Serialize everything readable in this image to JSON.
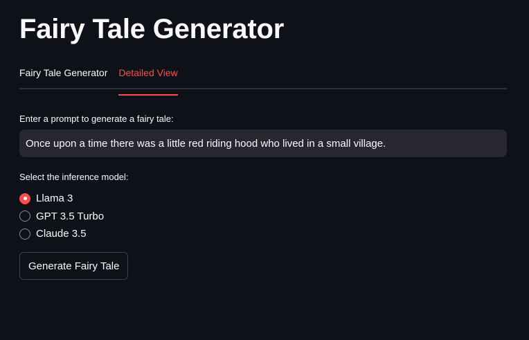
{
  "app": {
    "title": "Fairy Tale Generator"
  },
  "tabs": [
    {
      "label": "Fairy Tale Generator",
      "active": false
    },
    {
      "label": "Detailed View",
      "active": true
    }
  ],
  "prompt": {
    "label": "Enter a prompt to generate a fairy tale:",
    "value": "Once upon a time there was a little red riding hood who lived in a small village."
  },
  "model": {
    "label": "Select the inference model:",
    "options": [
      {
        "label": "Llama 3",
        "selected": true
      },
      {
        "label": "GPT 3.5 Turbo",
        "selected": false
      },
      {
        "label": "Claude 3.5",
        "selected": false
      }
    ]
  },
  "actions": {
    "generate_label": "Generate Fairy Tale"
  },
  "colors": {
    "background": "#0e1117",
    "accent": "#ff4b4b",
    "input_bg": "#262730",
    "text": "#fafafa"
  }
}
